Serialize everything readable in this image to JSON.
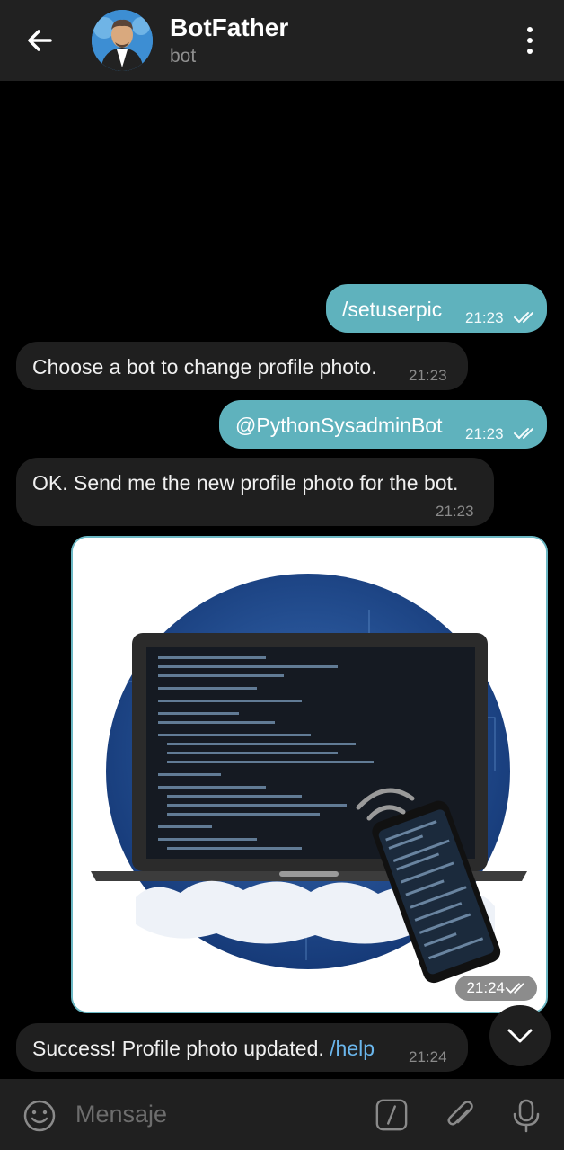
{
  "header": {
    "title": "BotFather",
    "subtitle": "bot"
  },
  "messages": {
    "m1": {
      "text": "/setuserpic",
      "time": "21:23"
    },
    "m2": {
      "text": "Choose a bot to change profile photo.",
      "time": "21:23"
    },
    "m3": {
      "text": "@PythonSysadminBot",
      "time": "21:23"
    },
    "m4": {
      "text": "OK. Send me the new profile photo for the bot.",
      "time": "21:23"
    },
    "m5": {
      "time": "21:24"
    },
    "m6": {
      "text": "Success! Profile photo updated.",
      "link": "/help",
      "time": "21:24"
    }
  },
  "input": {
    "placeholder": "Mensaje"
  },
  "colors": {
    "outgoing_bubble": "#5fb2bd",
    "incoming_bubble": "#1f1f1f",
    "link": "#6ab6ec"
  },
  "icons": [
    "back-arrow-icon",
    "more-vertical-icon",
    "double-check-icon",
    "chevron-down-icon",
    "emoji-icon",
    "bot-command-icon",
    "attach-icon",
    "microphone-icon"
  ]
}
